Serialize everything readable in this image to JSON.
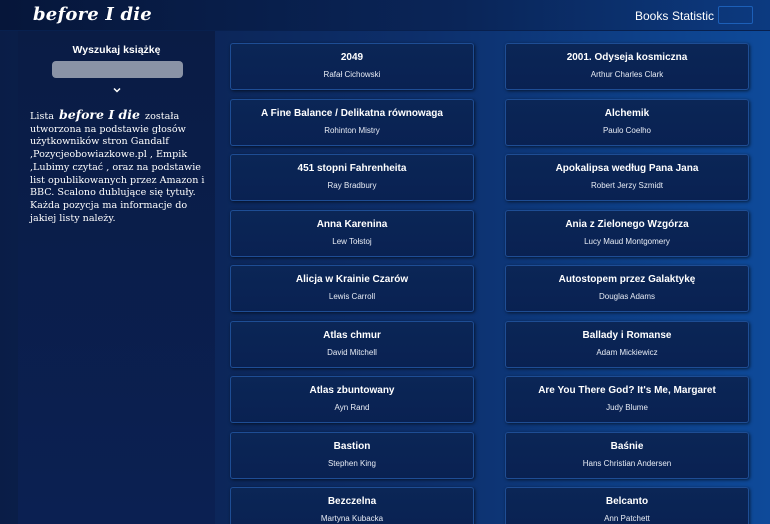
{
  "navbar": {
    "logo": "before I die",
    "links": [
      "Books",
      "Statistic"
    ]
  },
  "sidebar": {
    "search_title": "Wyszukaj książkę",
    "search_value": "",
    "text_before": "Lista",
    "logo": "before I die",
    "text_after": "została utworzona na podstawie głosów użytkowników stron Gandalf ,Pozycjeobowiazkowe.pl , Empik ,Lubimy czytać , oraz na podstawie list opublikowanych przez Amazon i BBC. Scalono dublujące się tytuły. Każda pozycja ma informacje do jakiej listy należy."
  },
  "books": [
    {
      "title": "2049",
      "author": "Rafał Cichowski"
    },
    {
      "title": "2001. Odyseja kosmiczna",
      "author": "Arthur Charles Clark"
    },
    {
      "title": "A Fine Balance / Delikatna równowaga",
      "author": "Rohinton Mistry"
    },
    {
      "title": "Alchemik",
      "author": "Paulo Coelho"
    },
    {
      "title": "451 stopni Fahrenheita",
      "author": "Ray Bradbury"
    },
    {
      "title": "Apokalipsa według Pana Jana",
      "author": "Robert Jerzy Szmidt"
    },
    {
      "title": "Anna Karenina",
      "author": "Lew Tołstoj"
    },
    {
      "title": "Ania z Zielonego Wzgórza",
      "author": "Lucy Maud Montgomery"
    },
    {
      "title": "Alicja w Krainie Czarów",
      "author": "Lewis Carroll"
    },
    {
      "title": "Autostopem przez Galaktykę",
      "author": "Douglas Adams"
    },
    {
      "title": "Atlas chmur",
      "author": "David Mitchell"
    },
    {
      "title": "Ballady i Romanse",
      "author": "Adam Mickiewicz"
    },
    {
      "title": "Atlas zbuntowany",
      "author": "Ayn Rand"
    },
    {
      "title": "Are You There God? It's Me, Margaret",
      "author": "Judy Blume"
    },
    {
      "title": "Bastion",
      "author": "Stephen King"
    },
    {
      "title": "Baśnie",
      "author": "Hans Christian Andersen"
    },
    {
      "title": "Bezczelna",
      "author": "Martyna Kubacka"
    },
    {
      "title": "Belcanto",
      "author": "Ann Patchett"
    }
  ]
}
